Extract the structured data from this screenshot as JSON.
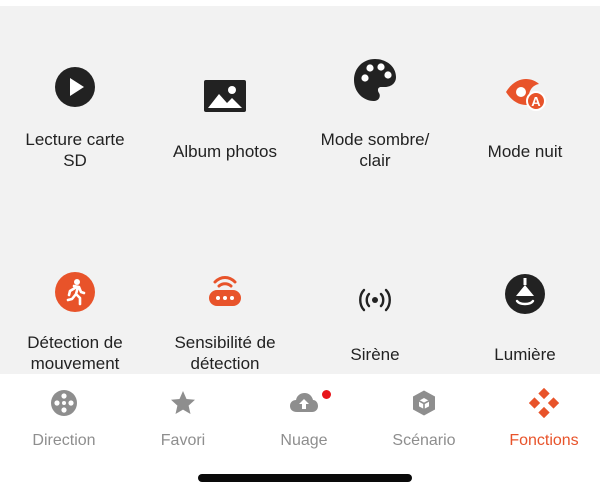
{
  "functions": [
    {
      "label": "Lecture carte\nSD",
      "icon": "play-circle-icon"
    },
    {
      "label": "Album photos",
      "icon": "image-icon"
    },
    {
      "label": "Mode sombre/\nclair",
      "icon": "palette-icon"
    },
    {
      "label": "Mode nuit",
      "icon": "eye-auto-icon"
    },
    {
      "label": "Détection de\nmouvement",
      "icon": "motion-person-icon"
    },
    {
      "label": "Sensibilité de\ndétection",
      "icon": "sensor-wifi-icon"
    },
    {
      "label": "Sirène",
      "icon": "siren-icon"
    },
    {
      "label": "Lumière",
      "icon": "lamp-icon"
    }
  ],
  "tabs": [
    {
      "label": "Direction",
      "icon": "direction-pad-icon",
      "active": false
    },
    {
      "label": "Favori",
      "icon": "star-icon",
      "active": false
    },
    {
      "label": "Nuage",
      "icon": "cloud-upload-icon",
      "active": false,
      "badge": true
    },
    {
      "label": "Scénario",
      "icon": "scenario-hex-icon",
      "active": false
    },
    {
      "label": "Fonctions",
      "icon": "functions-diamond-icon",
      "active": true
    }
  ],
  "colors": {
    "accent": "#e8532a",
    "dark_icon": "#222222",
    "tab_inactive": "#8e8e8e",
    "badge": "#e8161b",
    "background": "#f2f2f2"
  }
}
